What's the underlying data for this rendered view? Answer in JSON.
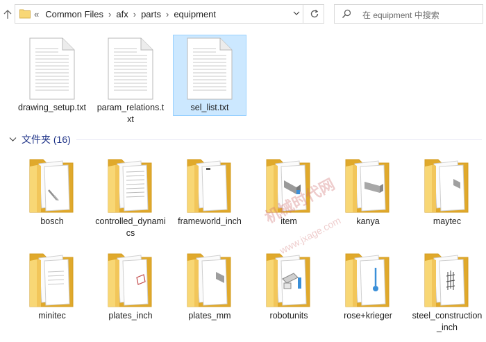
{
  "address_bar": {
    "overflow": "«",
    "crumbs": [
      "Common Files",
      "afx",
      "parts",
      "equipment"
    ]
  },
  "search": {
    "placeholder": "在 equipment 中搜索"
  },
  "files": [
    {
      "label": "drawing_setup.txt",
      "icon": "text-file-icon"
    },
    {
      "label": "param_relations.txt",
      "icon": "text-file-icon"
    },
    {
      "label": "sel_list.txt",
      "icon": "text-file-icon",
      "selected": true
    }
  ],
  "folders_group": {
    "title": "文件夹 (16)"
  },
  "folders": [
    {
      "label": "bosch"
    },
    {
      "label": "controlled_dynamics"
    },
    {
      "label": "frameworld_inch"
    },
    {
      "label": "item"
    },
    {
      "label": "kanya"
    },
    {
      "label": "maytec"
    },
    {
      "label": "minitec"
    },
    {
      "label": "plates_inch"
    },
    {
      "label": "plates_mm"
    },
    {
      "label": "robotunits"
    },
    {
      "label": "rose+krieger"
    },
    {
      "label": "steel_construction_inch"
    }
  ],
  "watermark": {
    "line1": "机械时代网",
    "line2": "www.jxage.com"
  },
  "colors": {
    "selection": "#cce8ff",
    "selection_border": "#99d1ff",
    "folder": "#f8d775",
    "group_text": "#1e3287"
  }
}
